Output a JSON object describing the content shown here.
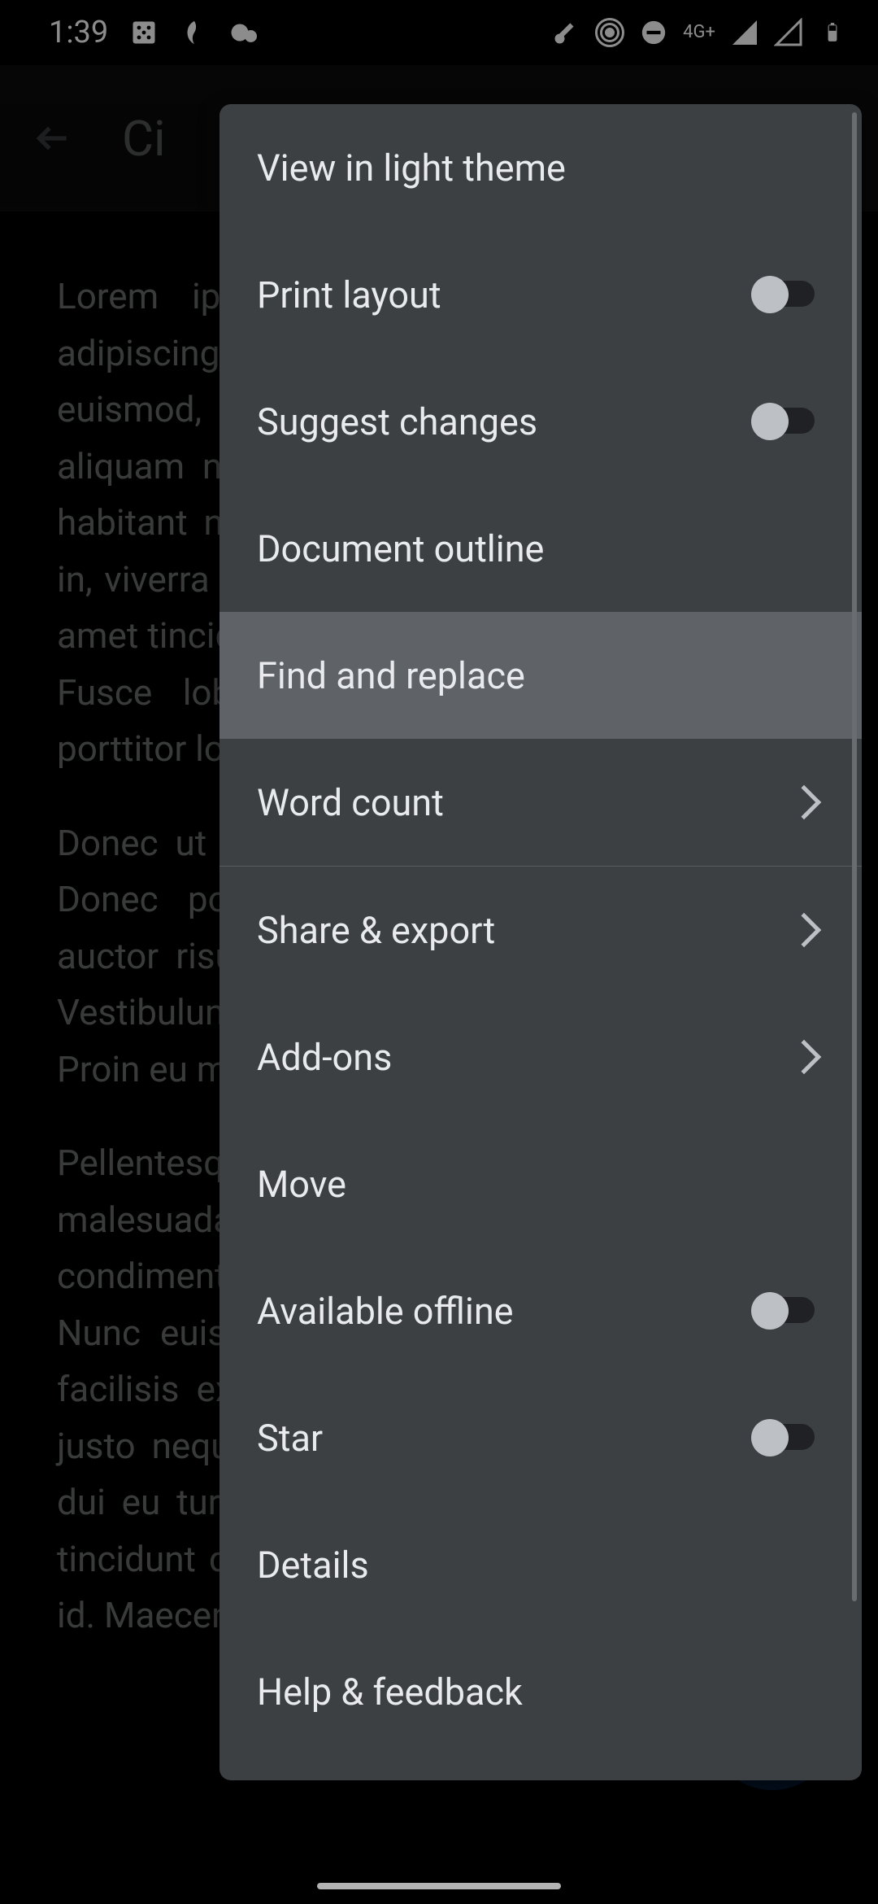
{
  "status_bar": {
    "time": "1:39",
    "network_label": "4G+"
  },
  "header": {
    "title": "Ci"
  },
  "document": {
    "p1": "Lorem ipsum dolor sit amet, consectetur adipiscing elit. Sed euismod, nisl ac volutpat euismod, nisl nisl aliquet efficitur ante, sed aliquam nisl nisl eu sagittis leo. Pellentesque habitant nulla vitae justo consequat dignissim in, viverra a, sem. Etiam sit amet orci eget eros amet tincidunt. Duis leo. Sed eu aliquam massa. Fusce lobortis mi eget volutpat. Nam mi porttitor lorem, id",
    "p2": "Donec ut libero sed arcu vehicula eget tortor. Donec posuere gravida, lorem iaculis. Sed auctor risus non pulvinar. Ut justo eu feugiat. Vestibulum massa ut tellus feugiat commodo. Proin eu mi. Sed imperdiet suscipit",
    "p3": "Pellentesque habitant morbi tristique et netus et malesuada fames. Quisque libero metus condimentum nec mauris id, sollicitudin orci. Nunc euismod, nisl vel finibus consequat, ex facilisis ex, eget aliquam imperdiet, nisl porta justo neque metus. Proin id lacus, porttitor et dui eu turpis. Nunc eu gravida nisi. Ut blandit tincidunt quam, varius elementum ante sagittis id. Maecenas pretium enim nec condimentum"
  },
  "menu": {
    "items": [
      {
        "label": "View in light theme",
        "kind": "plain"
      },
      {
        "label": "Print layout",
        "kind": "toggle",
        "on": false
      },
      {
        "label": "Suggest changes",
        "kind": "toggle",
        "on": false
      },
      {
        "label": "Document outline",
        "kind": "plain"
      },
      {
        "label": "Find and replace",
        "kind": "plain",
        "highlighted": true
      },
      {
        "label": "Word count",
        "kind": "chevron"
      },
      {
        "label": "Share & export",
        "kind": "chevron",
        "after_divider": true
      },
      {
        "label": "Add-ons",
        "kind": "chevron"
      },
      {
        "label": "Move",
        "kind": "plain"
      },
      {
        "label": "Available offline",
        "kind": "toggle",
        "on": false
      },
      {
        "label": "Star",
        "kind": "toggle",
        "on": false
      },
      {
        "label": "Details",
        "kind": "plain"
      },
      {
        "label": "Help & feedback",
        "kind": "plain"
      }
    ]
  }
}
